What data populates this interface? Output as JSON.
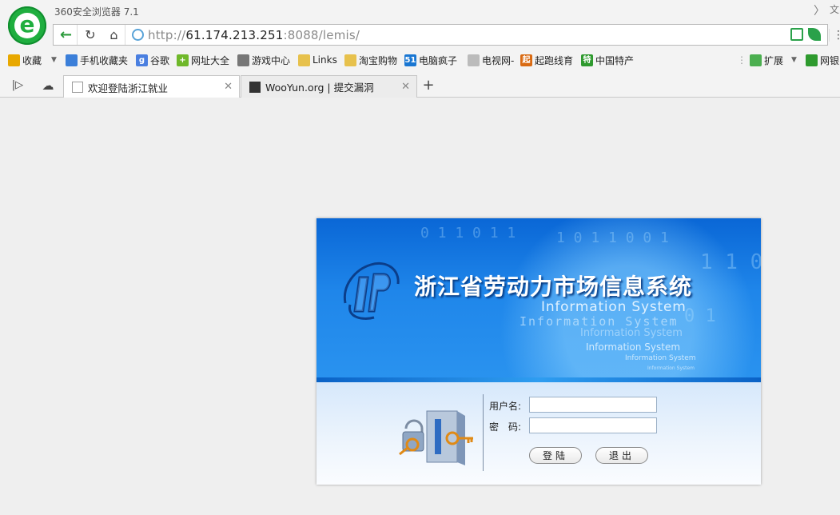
{
  "browser": {
    "app_title": "360安全浏览器 7.1",
    "window_controls": {
      "restore": "〉",
      "menu": "文"
    },
    "url": {
      "scheme": "http://",
      "host": "61.174.213.251",
      "rest": ":8088/lemis/"
    }
  },
  "bookmarks": [
    {
      "label": "收藏",
      "icon": "star-icon",
      "color": "#e8a800"
    },
    {
      "label": "手机收藏夹",
      "icon": "phone-icon",
      "color": "#3b7fd9"
    },
    {
      "label": "谷歌",
      "icon": "google-icon",
      "color": "#4a7fe0",
      "glyph": "g"
    },
    {
      "label": "网址大全",
      "icon": "plus-globe-icon",
      "color": "#6fb82a",
      "glyph": "+"
    },
    {
      "label": "游戏中心",
      "icon": "gamepad-icon",
      "color": "#777"
    },
    {
      "label": "Links",
      "icon": "folder-icon",
      "color": "#e7c14c"
    },
    {
      "label": "淘宝购物",
      "icon": "folder-icon",
      "color": "#e7c14c"
    },
    {
      "label": "电脑疯子",
      "icon": "badge-51-icon",
      "color": "#1976d2",
      "glyph": "51"
    },
    {
      "label": "电视网-",
      "icon": "page-icon",
      "color": "#bbb"
    },
    {
      "label": "起跑线育",
      "icon": "badge-qi-icon",
      "color": "#d96a12",
      "glyph": "起"
    },
    {
      "label": "中国特产",
      "icon": "badge-te-icon",
      "color": "#2e9a2e",
      "glyph": "特"
    },
    {
      "label": "扩展",
      "icon": "extensions-icon",
      "color": "#4caf50"
    },
    {
      "label": "网银",
      "icon": "shield-icon",
      "color": "#2e9a2e"
    }
  ],
  "tabs": [
    {
      "label": "欢迎登陆浙江就业",
      "active": true
    },
    {
      "label": "WooYun.org | 提交漏洞",
      "active": false
    }
  ],
  "page": {
    "system_title": "浙江省劳动力市场信息系统",
    "subtitle": "Information System",
    "form": {
      "username_label": "用户名:",
      "password_label": "密　码:",
      "username_value": "",
      "password_value": "",
      "login_button": "登陆",
      "exit_button": "退出"
    }
  }
}
